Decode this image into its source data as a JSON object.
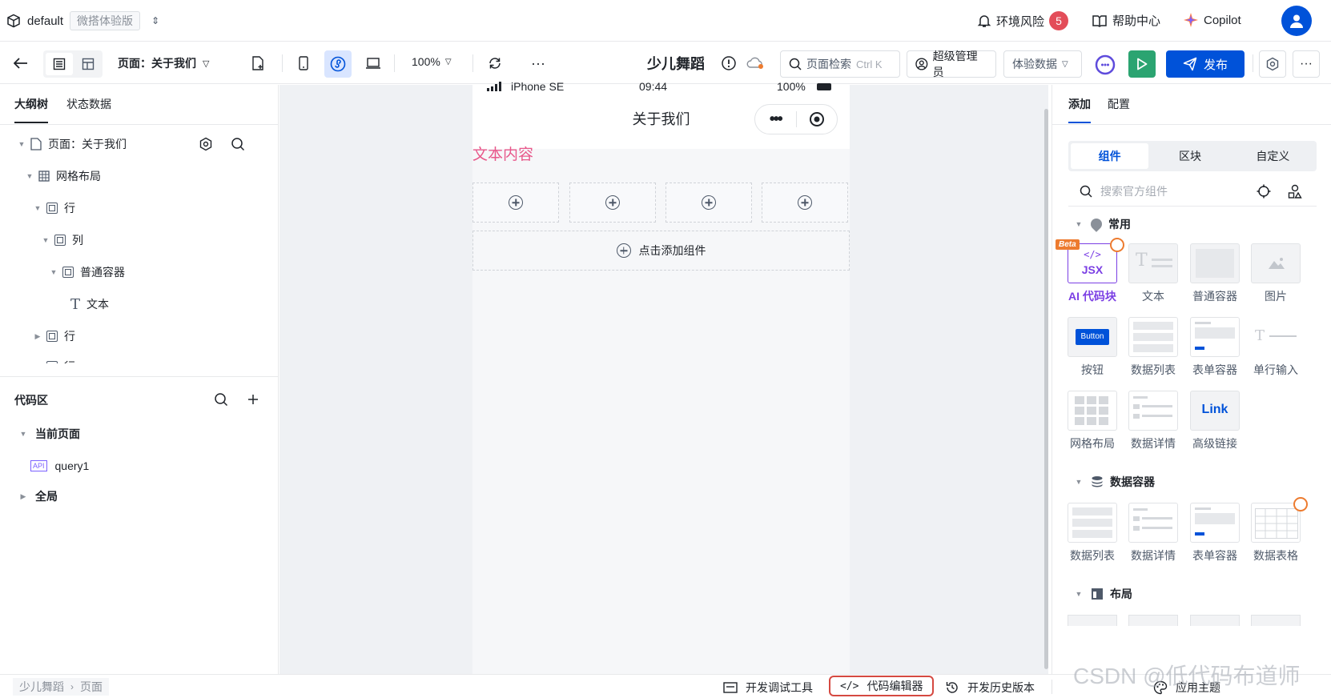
{
  "topbar": {
    "workspace": "default",
    "edition_badge": "微搭体验版",
    "env_risk_label": "环境风险",
    "env_risk_count": "5",
    "help_label": "帮助中心",
    "copilot_label": "Copilot"
  },
  "toolbar": {
    "page_label": "页面：关于我们",
    "zoom": "100%",
    "app_name": "少儿舞蹈",
    "search_placeholder": "页面检索",
    "search_shortcut": "Ctrl K",
    "role_label": "超级管理员",
    "data_env_label": "体验数据",
    "publish_label": "发布"
  },
  "left": {
    "tabs": [
      "大纲树",
      "状态数据"
    ],
    "tree": [
      {
        "label": "页面：关于我们"
      },
      {
        "label": "网格布局"
      },
      {
        "label": "行"
      },
      {
        "label": "列"
      },
      {
        "label": "普通容器"
      },
      {
        "label": "文本"
      },
      {
        "label": "行"
      },
      {
        "label": "行"
      }
    ],
    "code_title": "代码区",
    "code_sections": [
      "当前页面",
      "全局"
    ],
    "api_badge": "API",
    "query_label": "query1"
  },
  "canvas": {
    "device": "iPhone SE",
    "time": "09:44",
    "battery": "100%",
    "page_title": "关于我们",
    "text_content": "文本内容",
    "add_component_label": "点击添加组件"
  },
  "right": {
    "tabs": [
      "添加",
      "配置"
    ],
    "segments": [
      "组件",
      "区块",
      "自定义"
    ],
    "search_placeholder": "搜索官方组件",
    "sections": {
      "common": {
        "title": "常用",
        "items": [
          "AI 代码块",
          "文本",
          "普通容器",
          "图片",
          "按钮",
          "数据列表",
          "表单容器",
          "单行输入",
          "网格布局",
          "数据详情",
          "高级链接"
        ]
      },
      "data": {
        "title": "数据容器",
        "items": [
          "数据列表",
          "数据详情",
          "表单容器",
          "数据表格"
        ]
      },
      "layout": {
        "title": "布局"
      }
    },
    "beta_badge": "Beta",
    "jsx_text": "JSX",
    "button_thumb_text": "Button",
    "link_thumb_text": "Link"
  },
  "statusbar": {
    "breadcrumb": [
      "少儿舞蹈",
      "页面"
    ],
    "dev_tools": "开发调试工具",
    "code_editor": "代码编辑器",
    "history": "开发历史版本",
    "theme": "应用主题",
    "watermark": "CSDN @低代码布道师"
  },
  "colors": {
    "primary": "#0052d9",
    "badge_red": "#e34d59",
    "text_pink": "#e8588b",
    "ai_purple": "#7b3fe4",
    "green": "#2ba471",
    "highlight_red": "#d54941"
  }
}
